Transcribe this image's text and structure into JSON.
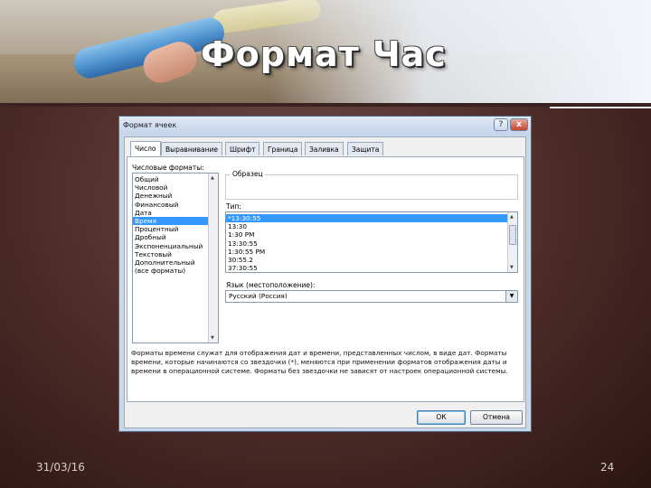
{
  "slide": {
    "title": "Формат Час",
    "date": "31/03/16",
    "page_number": "24"
  },
  "dialog": {
    "title": "Формат ячеек",
    "help_label": "?",
    "close_label": "x",
    "tabs": [
      {
        "label": "Число",
        "active": true
      },
      {
        "label": "Выравнивание",
        "active": false
      },
      {
        "label": "Шрифт",
        "active": false
      },
      {
        "label": "Граница",
        "active": false
      },
      {
        "label": "Заливка",
        "active": false
      },
      {
        "label": "Защита",
        "active": false
      }
    ],
    "formats_label": "Числовые форматы:",
    "formats": [
      "Общий",
      "Числовой",
      "Денежный",
      "Финансовый",
      "Дата",
      "Время",
      "Процентный",
      "Дробный",
      "Экспоненциальный",
      "Текстовый",
      "Дополнительный",
      "(все форматы)"
    ],
    "selected_format": "Время",
    "sample_label": "Образец",
    "type_label": "Тип:",
    "types": [
      "*13:30:55",
      "13:30",
      "1:30 PM",
      "13:30:55",
      "1:30:55 PM",
      "30:55.2",
      "37:30:55"
    ],
    "selected_type": "*13:30:55",
    "locale_label": "Язык (местоположение):",
    "locale_value": "Русский (Россия)",
    "description": "Форматы времени служат для отображения дат и времени, представленных числом, в виде дат. Форматы времени, которые начинаются со звездочки (*), меняются при применении форматов отображения даты и времени в операционной системе. Форматы без звездочки не зависят от настроек операционной системы.",
    "ok_label": "ОК",
    "cancel_label": "Отмена"
  }
}
